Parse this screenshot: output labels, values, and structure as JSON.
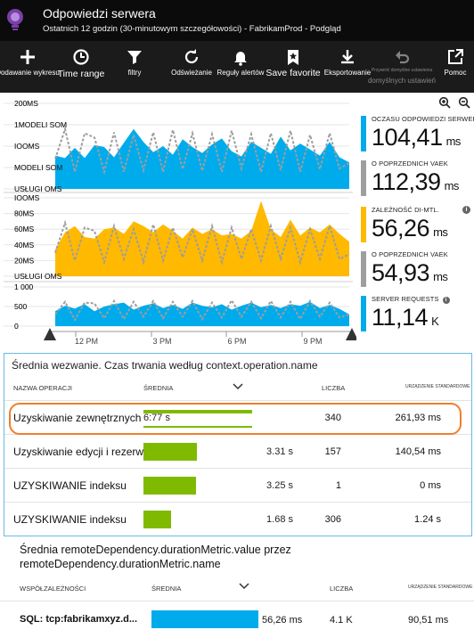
{
  "header": {
    "title": "Odpowiedzi serwera",
    "subtitle": "Ostatnich 12 godzin (30-minutowym szczegółowości) - FabrikamProd - Podgląd"
  },
  "toolbar": {
    "add": "Dodawanie wykresu",
    "time_range": "Time range",
    "filters": "filtry",
    "refresh": "Odświeżanie",
    "alert_rules": "Reguły alertów",
    "save_favorite": "Save favorite",
    "export": "Eksportowanie",
    "restore_defaults": "domyślnych ustawień",
    "restore_defaults_prefix": "Przywróć domyślne ustawienia",
    "help": "Pomoc"
  },
  "charts": {
    "top": {
      "ticks": [
        "200MS",
        "1MODELI SOM",
        "IOOMS",
        "MODELI SOM",
        "USŁUGI OMS"
      ],
      "series_a_color": "#00abec",
      "series_b_color": "#9e9e9e"
    },
    "middle": {
      "ticks": [
        "IOOMS",
        "80MS",
        "60MS",
        "40MS",
        "20MS",
        "USŁUGI OMS"
      ],
      "series_a_color": "#ffb900",
      "series_b_color": "#9e9e9e"
    },
    "bottom": {
      "ticks": [
        "1 000",
        "500",
        "0"
      ],
      "series_a_color": "#00abec"
    },
    "x_ticks": [
      "12 PM",
      "3 PM",
      "6 PM",
      "9 PM"
    ]
  },
  "chart_data": [
    {
      "type": "area",
      "title": "",
      "series": [
        {
          "name": "CZAS ODPOWIEDZI SERWERA",
          "values": [
            78,
            72,
            96,
            72,
            102,
            98,
            74,
            108,
            140,
            110,
            86,
            100,
            80,
            116,
            98,
            84,
            104,
            118,
            88,
            76,
            110,
            96,
            82,
            122,
            90,
            106,
            92,
            78,
            110,
            74,
            62
          ]
        },
        {
          "name": "O POPRZEDNICH VAEK",
          "values": [
            70,
            140,
            40,
            130,
            120,
            40,
            132,
            40,
            126,
            44,
            132,
            40,
            138,
            46,
            130,
            42,
            128,
            40,
            136,
            48,
            128,
            40,
            130,
            44,
            136,
            40,
            126,
            46,
            130,
            48,
            60
          ]
        }
      ]
    },
    {
      "type": "area",
      "title": "",
      "series": [
        {
          "name": "ZALEŻNOŚĆ DI-MTL",
          "values": [
            34,
            56,
            64,
            50,
            48,
            60,
            62,
            54,
            70,
            64,
            56,
            66,
            58,
            48,
            62,
            54,
            60,
            52,
            54,
            48,
            58,
            96,
            60,
            50,
            72,
            52,
            62,
            56,
            66,
            54,
            44
          ]
        },
        {
          "name": "O POPRZEDNICH VAEK",
          "values": [
            30,
            68,
            20,
            62,
            58,
            18,
            64,
            22,
            60,
            18,
            66,
            20,
            62,
            24,
            60,
            20,
            64,
            18,
            62,
            22,
            60,
            20,
            64,
            22,
            62,
            18,
            60,
            22,
            64,
            22,
            28
          ]
        }
      ]
    },
    {
      "type": "area",
      "title": "",
      "series": [
        {
          "name": "SERVER REQUESTS",
          "values": [
            380,
            520,
            450,
            560,
            380,
            500,
            560,
            600,
            420,
            520,
            580,
            460,
            540,
            440,
            600,
            520,
            480,
            560,
            420,
            520,
            600,
            480,
            540,
            460,
            560,
            520,
            620,
            460,
            540,
            440,
            300
          ]
        },
        {
          "name": "O POPRZEDNICH VAEK",
          "values": [
            300,
            620,
            160,
            600,
            580,
            200,
            640,
            180,
            620,
            240,
            640,
            200,
            620,
            240,
            640,
            180,
            600,
            220,
            660,
            240,
            620,
            200,
            640,
            220,
            620,
            180,
            640,
            240,
            600,
            220,
            300
          ]
        }
      ]
    }
  ],
  "metrics": [
    {
      "label": "OCZASU ODPOWIEDZI SERWERA",
      "value": "104,41",
      "unit": "ms",
      "color": "#00abec"
    },
    {
      "label": "O POPRZEDNICH VAEK",
      "value": "112,39",
      "unit": "ms",
      "color": "#9e9e9e"
    },
    {
      "label": "ZALEŻNOŚĆ DI-MTL.",
      "value": "56,26",
      "unit": "ms",
      "color": "#ffb900"
    },
    {
      "label": "O POPRZEDNICH VAEK",
      "value": "54,93",
      "unit": "ms",
      "color": "#9e9e9e"
    },
    {
      "label": "SERVER REQUESTS",
      "value": "11,14",
      "unit": "K",
      "color": "#00abec"
    }
  ],
  "table1": {
    "title": "Średnia wezwanie. Czas trwania według context.operation.name",
    "columns": [
      "NAZWA OPERACJI",
      "ŚREDNIA",
      "LICZBA",
      "URZĄDZENIE STANDARDOWE"
    ],
    "rows": [
      {
        "name": "Uzyskiwanie zewnętrznych",
        "avg": "6:77 s",
        "avg_fraction": 1.0,
        "count": "340",
        "std": "261,93 ms"
      },
      {
        "name": "Uzyskiwanie edycji i rezerwacji",
        "avg": "3.31 s",
        "avg_fraction": 0.49,
        "count": "157",
        "std": "140,54 ms"
      },
      {
        "name": "UZYSKIWANIE indeksu",
        "avg": "3.25 s",
        "avg_fraction": 0.48,
        "count": "1",
        "std": "0 ms"
      },
      {
        "name": "UZYSKIWANIE indeksu",
        "avg": "1.68 s",
        "avg_fraction": 0.25,
        "count": "306",
        "std": "1.24 s"
      }
    ]
  },
  "table2": {
    "title_line1": "Średnia remoteDependency.durationMetric.value przez",
    "title_line2": "remoteDependency.durationMetric.name",
    "columns": [
      "WSPÓŁZALEŻNOŚCI",
      "ŚREDNIA",
      "LICZBA",
      "URZĄDZENIE STANDARDOWE"
    ],
    "rows": [
      {
        "name": "SQL: tcp:fabrikamxyz.d...",
        "avg": "56,26 ms",
        "avg_fraction": 1.0,
        "count": "4.1 K",
        "std": "90,51 ms"
      }
    ]
  }
}
